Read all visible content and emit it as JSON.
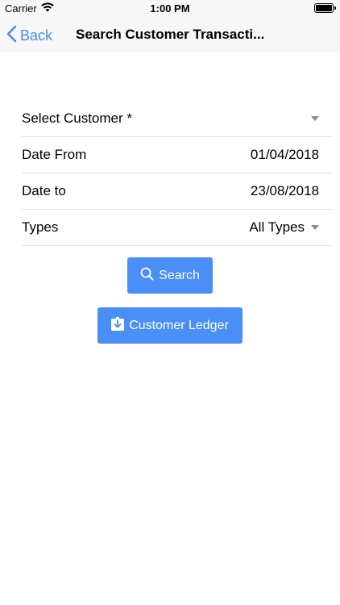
{
  "status_bar": {
    "carrier": "Carrier",
    "time": "1:00 PM"
  },
  "nav": {
    "back_label": "Back",
    "title": "Search Customer Transacti..."
  },
  "form": {
    "customer_label": "Select Customer *",
    "date_from_label": "Date From",
    "date_from_value": "01/04/2018",
    "date_to_label": "Date to",
    "date_to_value": "23/08/2018",
    "types_label": "Types",
    "types_value": "All Types"
  },
  "buttons": {
    "search_label": "Search",
    "ledger_label": "Customer Ledger"
  },
  "colors": {
    "accent": "#4a8fe2",
    "button": "#4a8ff7"
  },
  "icons": {
    "wifi": "wifi-icon",
    "battery": "battery-icon",
    "back": "chevron-left-icon",
    "search": "search-icon",
    "ledger": "download-icon"
  }
}
